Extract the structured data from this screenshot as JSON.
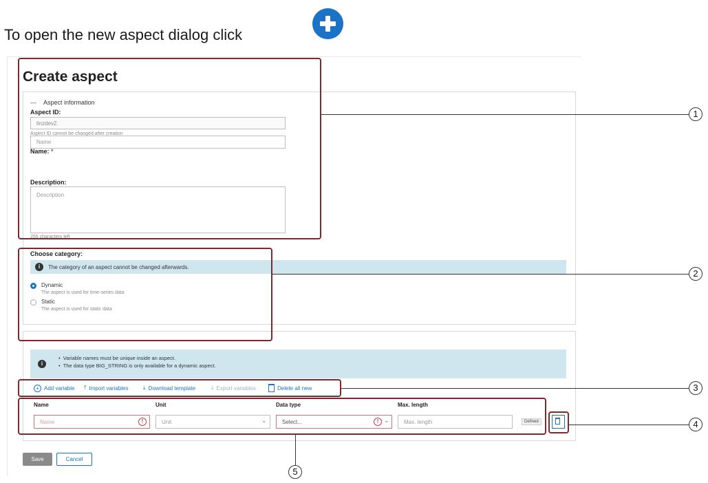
{
  "intro_text": "To open the new aspect dialog click",
  "page_title": "Create aspect",
  "aspect_info": {
    "section_label": "Aspect information",
    "aspect_id_label": "Aspect ID:",
    "aspect_id_value": "linzdev2.",
    "aspect_id_hint": "Aspect ID cannot be changed after creation",
    "name_label": "Name:",
    "required_mark": "*",
    "name_placeholder": "Name",
    "description_label": "Description:",
    "description_placeholder": "Description",
    "chars_left": "255 characters left"
  },
  "category": {
    "label": "Choose category:",
    "notice": "The category of an aspect cannot be changed afterwards.",
    "options": [
      {
        "label": "Dynamic",
        "hint": "The aspect is used for time-series data",
        "selected": true
      },
      {
        "label": "Static",
        "hint": "The aspect is used for static data",
        "selected": false
      }
    ]
  },
  "variables": {
    "notices": [
      "Variable names must be unique inside an aspect.",
      "The data type BIG_STRING is only available for a dynamic aspect."
    ],
    "toolbar": {
      "add": "Add variable",
      "import": "Import variables",
      "download": "Download template",
      "export": "Export variables",
      "delete": "Delete all new"
    },
    "columns": [
      "Name",
      "Unit",
      "Data type",
      "Max. length"
    ],
    "row": {
      "name_placeholder": "Name",
      "unit_placeholder": "Unit",
      "datatype_placeholder": "Select...",
      "maxlength_placeholder": "Max. length",
      "badge": "Defined"
    }
  },
  "buttons": {
    "save": "Save",
    "cancel": "Cancel"
  },
  "callouts": [
    "1",
    "2",
    "3",
    "4",
    "5"
  ],
  "colors": {
    "accent": "#1b73c8",
    "callout_box": "#7a2a2a",
    "info_bar": "#cfe6ee",
    "error": "#d23b4a"
  }
}
